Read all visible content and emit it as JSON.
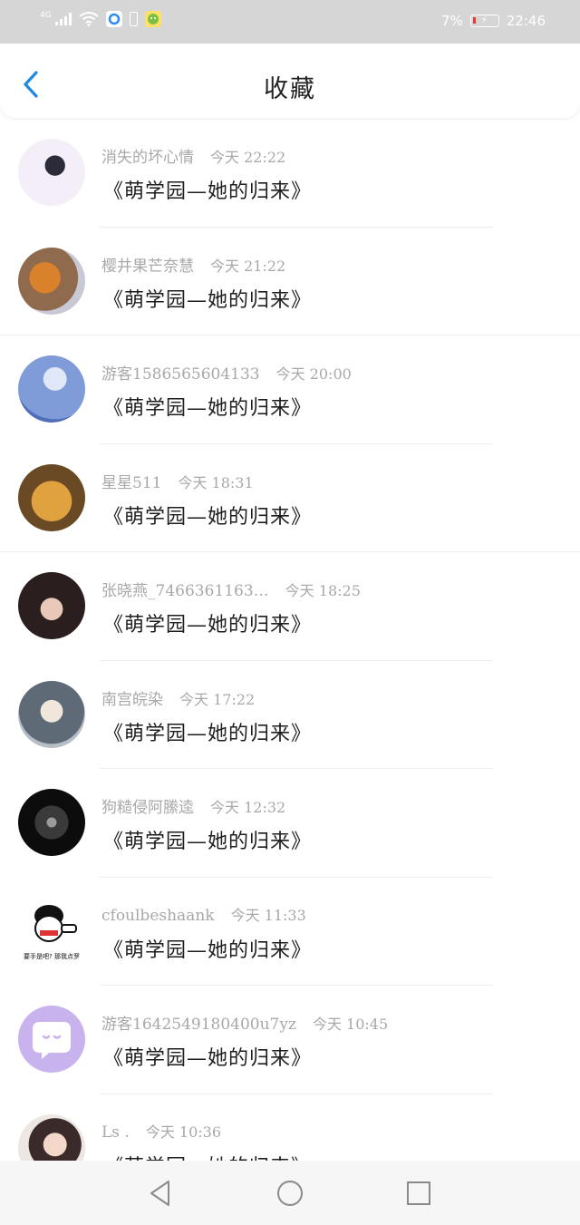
{
  "status_bar": {
    "network": "4G",
    "battery": "7%",
    "time": "22:46"
  },
  "header": {
    "title": "收藏"
  },
  "favorites": [
    {
      "user": "消失的坏心情",
      "time": "今天  22:22",
      "work": "《萌学园—她的归来》",
      "avatar_color": "#d9d2e6"
    },
    {
      "user": "樱井果芒奈慧",
      "time": "今天  21:22",
      "work": "《萌学园—她的归来》",
      "avatar_color": "#c07a3e"
    },
    {
      "user": "游客1586565604133",
      "time": "今天  20:00",
      "work": "《萌学园—她的归来》",
      "avatar_color": "#7f9bd8"
    },
    {
      "user": "星星511",
      "time": "今天  18:31",
      "work": "《萌学园—她的归来》",
      "avatar_color": "#c98a2d"
    },
    {
      "user": "张晓燕_7466361163…",
      "time": "今天  18:25",
      "work": "《萌学园—她的归来》",
      "avatar_color": "#4a3030"
    },
    {
      "user": "南宫皖染",
      "time": "今天  17:22",
      "work": "《萌学园—她的归来》",
      "avatar_color": "#6f7b88"
    },
    {
      "user": "狗糙侵阿縢逵",
      "time": "今天  12:32",
      "work": "《萌学园—她的归来》",
      "avatar_color": "#111111"
    },
    {
      "user": "cfoulbeshaank",
      "time": "今天  11:33",
      "work": "《萌学园—她的归来》",
      "avatar_color": "#ffffff",
      "avatar_caption": "要手是吧? 那我点罗"
    },
    {
      "user": "游客1642549180400u7yz",
      "time": "今天  10:45",
      "work": "《萌学园—她的归来》",
      "avatar_color": "#c9b3ef"
    },
    {
      "user": "Ls .",
      "time": "今天  10:36",
      "work": "《萌学园—她的归来》",
      "avatar_color": "#d7b9a7"
    }
  ],
  "colors": {
    "accent": "#1e88e5",
    "status_bar": "#d6d6d6"
  }
}
